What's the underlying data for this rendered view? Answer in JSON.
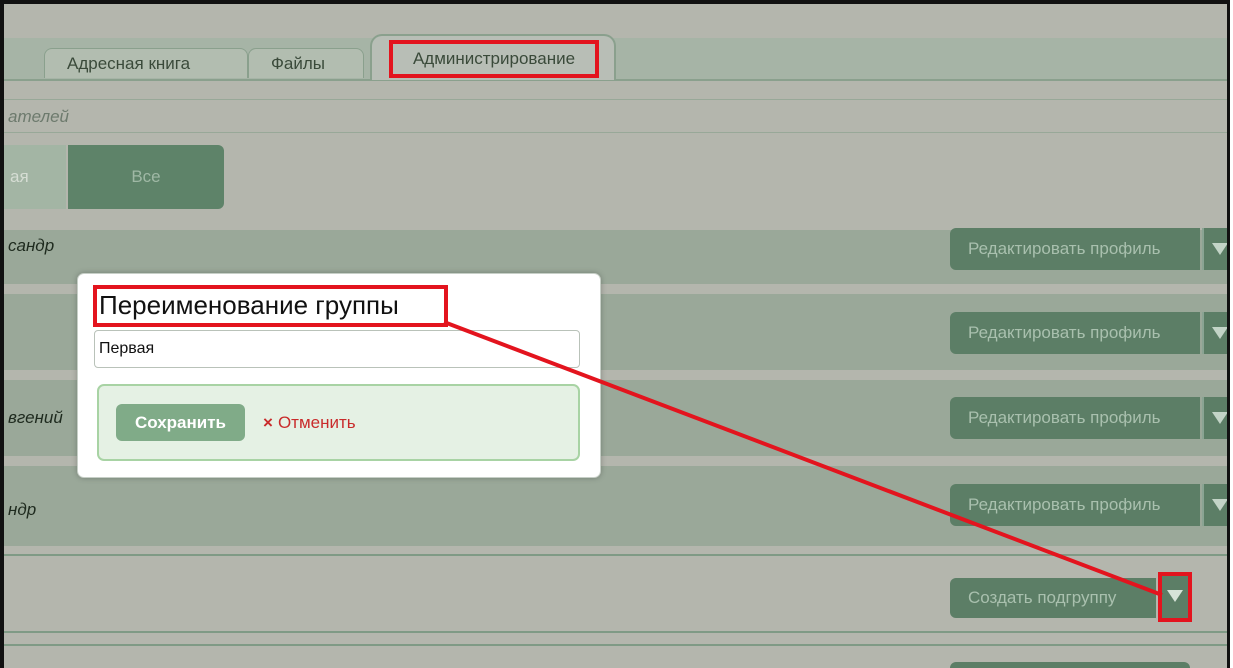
{
  "tabs": [
    {
      "label": "Адресная книга"
    },
    {
      "label": "Файлы"
    },
    {
      "label": "Администрирование"
    }
  ],
  "subtitle": "ателей",
  "filter": {
    "left_label": "ая",
    "right_label": "Все"
  },
  "rows": [
    {
      "name": "сандр",
      "button": "Редактировать профиль"
    },
    {
      "name": "",
      "button": "Редактировать профиль"
    },
    {
      "name": "вгений",
      "button": "Редактировать профиль"
    },
    {
      "name": "ндр",
      "button": "Редактировать профиль"
    }
  ],
  "subgroup_button": "Создать подгруппу",
  "dialog": {
    "title": "Переименование группы",
    "input_value": "Первая",
    "save_label": "Сохранить",
    "cancel_label": "Отменить",
    "cancel_icon": "×"
  },
  "colors": {
    "highlight": "#e3141e",
    "accent": "#5c7e66",
    "panel": "#e5f1e4"
  }
}
